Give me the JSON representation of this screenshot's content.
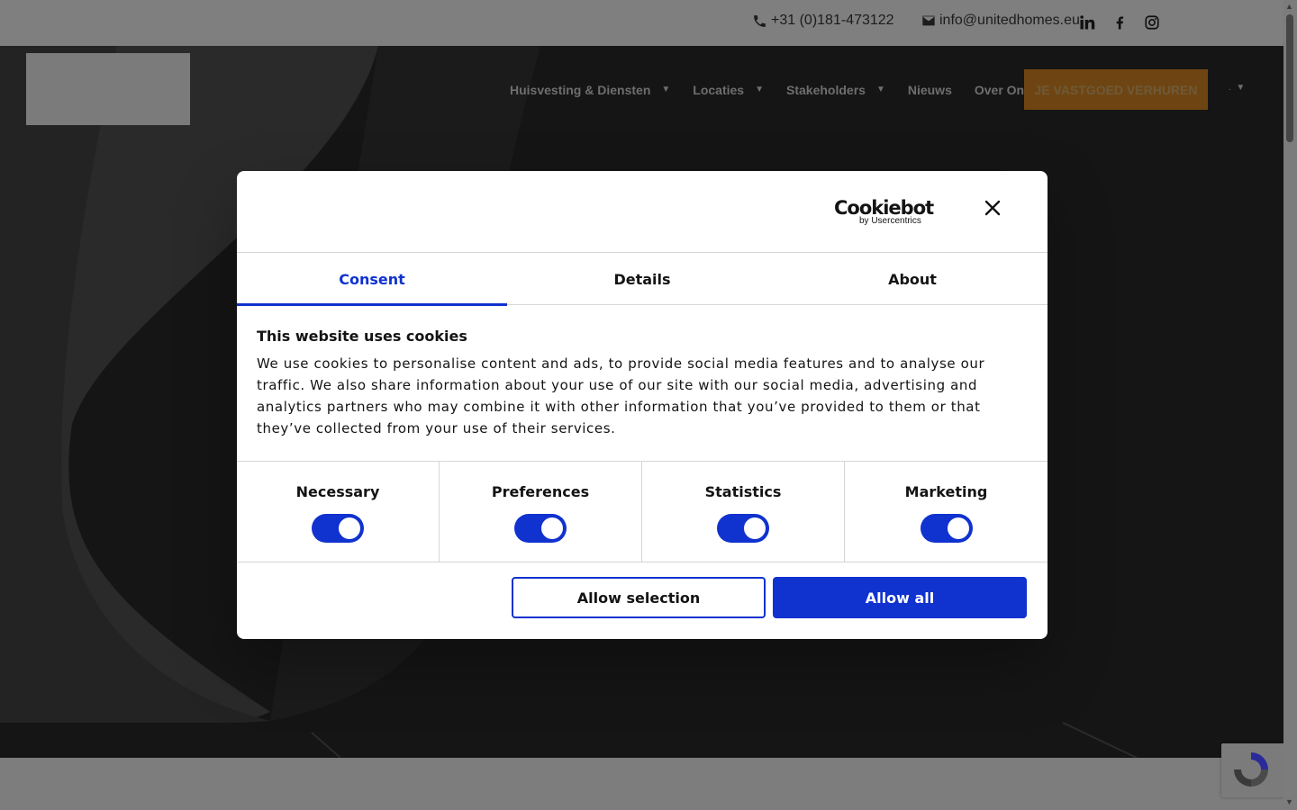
{
  "topbar": {
    "phone": "+31 (0)181-473122",
    "email": "info@unitedhomes.eu",
    "social": [
      "linkedin-icon",
      "facebook-icon",
      "instagram-icon"
    ]
  },
  "nav": {
    "items": [
      {
        "label": "Huisvesting & Diensten",
        "has_caret": true
      },
      {
        "label": "Locaties",
        "has_caret": true
      },
      {
        "label": "Stakeholders",
        "has_caret": true
      },
      {
        "label": "Nieuws",
        "has_caret": false
      },
      {
        "label": "Over Ons",
        "has_caret": true
      }
    ],
    "cta_label": "JE VASTGOED VERHUREN",
    "caret": "▼",
    "lang_label": "."
  },
  "dialog": {
    "brand": "Cookiebot",
    "brand_sub": "by Usercentrics",
    "tabs": [
      "Consent",
      "Details",
      "About"
    ],
    "active_tab": "Consent",
    "title": "This website uses cookies",
    "text": "We use cookies to personalise content and ads, to provide social media features and to analyse our traffic. We also share information about your use of our site with our social media, advertising and analytics partners who may combine it with other information that you’ve provided to them or that they’ve collected from your use of their services.",
    "categories": [
      {
        "label": "Necessary",
        "on": true
      },
      {
        "label": "Preferences",
        "on": true
      },
      {
        "label": "Statistics",
        "on": true
      },
      {
        "label": "Marketing",
        "on": true
      }
    ],
    "btn_selection": "Allow selection",
    "btn_all": "Allow all"
  },
  "colors": {
    "accent": "#1032cf",
    "cta": "#c87f24",
    "overlay_bg": "#7d7d7d",
    "hero": "#151515"
  }
}
